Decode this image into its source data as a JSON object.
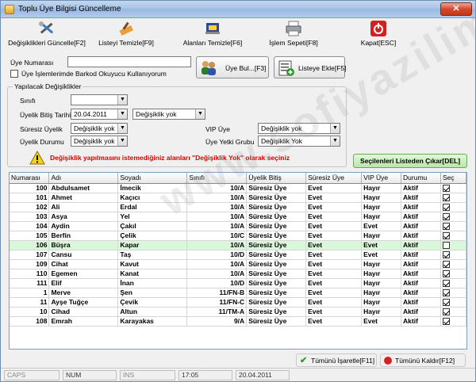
{
  "window": {
    "title": "Toplu Üye Bilgisi Güncelleme",
    "close_glyph": "✕"
  },
  "toolbar": {
    "items": [
      {
        "label": "Değişiklikleri Güncelle[F2]",
        "icon": "tools-icon"
      },
      {
        "label": "Listeyi Temizle[F9]",
        "icon": "eraser-icon"
      },
      {
        "label": "Alanları Temizle[F6]",
        "icon": "broom-icon"
      },
      {
        "label": "İşlem Sepeti[F8]",
        "icon": "printer-icon"
      },
      {
        "label": "Kapat[ESC]",
        "icon": "power-icon"
      }
    ]
  },
  "member": {
    "number_label": "Üye Numarası",
    "number_value": "",
    "barcode_label": "Üye İşlemlerimde Barkod Okuyucu Kullanıyorum",
    "barcode_checked": false,
    "find_button": "Üye Bul...[F3]",
    "add_list_button": "Listeye Ekle[F5]"
  },
  "changes": {
    "group_title": "Yapılacak Değişiklikler",
    "class_label": "Sınıfı",
    "class_value": "",
    "expiry_label": "Üyelik Bitiş Tarihi",
    "expiry_date": "20.04.2011",
    "expiry_mode": "Değişiklik yok",
    "unlimited_label": "Süresiz Üyelik",
    "unlimited_value": "Değişiklik yok",
    "status_label": "Üyelik Durumu",
    "status_value": "Değişiklik yok",
    "vip_label": "VIP Üye",
    "vip_value": "Değişiklik yok",
    "auth_label": "Üye Yetki Grubu",
    "auth_value": "Değişiklik Yok"
  },
  "warning": {
    "text": "Değişiklik yapılmasını istemediğiniz alanları \"Değişiklik Yok\" olarak seçiniz",
    "remove_button": "Seçilenleri Listeden Çıkar[DEL]"
  },
  "grid": {
    "columns": [
      "Numarası",
      "Adı",
      "Soyadı",
      "Sınıfı",
      "Üyelik Bitiş",
      "Süresiz Üye",
      "VIP Üye",
      "Durumu",
      "Seç"
    ],
    "rows": [
      [
        "100",
        "Abdulsamet",
        "İmecik",
        "10/A",
        "Süresiz Üye",
        "Evet",
        "Hayır",
        "Aktif",
        true
      ],
      [
        "101",
        "Ahmet",
        "Kaçıcı",
        "10/A",
        "Süresiz Üye",
        "Evet",
        "Hayır",
        "Aktif",
        true
      ],
      [
        "102",
        "Ali",
        "Erdal",
        "10/A",
        "Süresiz Üye",
        "Evet",
        "Hayır",
        "Aktif",
        true
      ],
      [
        "103",
        "Asya",
        "Yel",
        "10/A",
        "Süresiz Üye",
        "Evet",
        "Hayır",
        "Aktif",
        true
      ],
      [
        "104",
        "Aydin",
        "Çakıl",
        "10/A",
        "Süresiz Üye",
        "Evet",
        "Evet",
        "Aktif",
        true
      ],
      [
        "105",
        "Berfin",
        "Çelik",
        "10/C",
        "Süresiz Üye",
        "Evet",
        "Hayır",
        "Aktif",
        true
      ],
      [
        "106",
        "Büşra",
        "Kapar",
        "10/A",
        "Süresiz Üye",
        "Evet",
        "Evet",
        "Aktif",
        false
      ],
      [
        "107",
        "Cansu",
        "Taş",
        "10/D",
        "Süresiz Üye",
        "Evet",
        "Evet",
        "Aktif",
        true
      ],
      [
        "109",
        "Cihat",
        "Kavut",
        "10/A",
        "Süresiz Üye",
        "Evet",
        "Hayır",
        "Aktif",
        true
      ],
      [
        "110",
        "Egemen",
        "Kanat",
        "10/A",
        "Süresiz Üye",
        "Evet",
        "Hayır",
        "Aktif",
        true
      ],
      [
        "111",
        "Elif",
        "İnan",
        "10/D",
        "Süresiz Üye",
        "Evet",
        "Hayır",
        "Aktif",
        true
      ],
      [
        "1",
        "Merve",
        "Şen",
        "11/FN-B",
        "Süresiz Üye",
        "Evet",
        "Hayır",
        "Aktif",
        true
      ],
      [
        "11",
        "Ayşe Tuğçe",
        "Çevik",
        "11/FN-C",
        "Süresiz Üye",
        "Evet",
        "Hayır",
        "Aktif",
        true
      ],
      [
        "10",
        "Cihad",
        "Altun",
        "11/TM-A",
        "Süresiz Üye",
        "Evet",
        "Hayır",
        "Aktif",
        true
      ],
      [
        "108",
        "Emrah",
        "Karayakas",
        "9/A",
        "Süresiz Üye",
        "Evet",
        "Evet",
        "Aktif",
        true
      ]
    ]
  },
  "footer": {
    "check_all": "Tümünü İşaretle[F11]",
    "uncheck_all": "Tümünü Kaldır[F12]"
  },
  "statusbar": {
    "caps": "CAPS",
    "num": "NUM",
    "ins": "INS",
    "time": "17:05",
    "date": "20.04.2011"
  },
  "watermark": "www.sofiyazilim.com"
}
